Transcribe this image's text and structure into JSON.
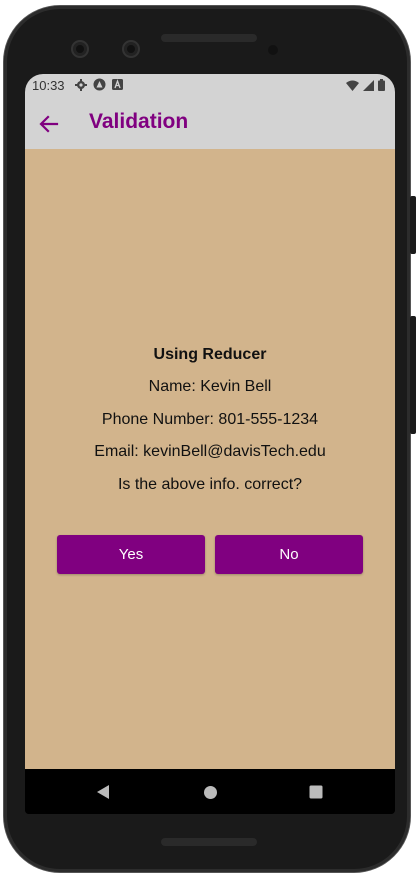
{
  "status_bar": {
    "time": "10:33",
    "left_icons": [
      "gear-icon",
      "app-circle-icon",
      "a-box-icon"
    ],
    "right_icons": [
      "wifi-icon",
      "cell-signal-icon",
      "battery-icon"
    ]
  },
  "app_bar": {
    "back_icon": "arrow-left-icon",
    "title": "Validation"
  },
  "summary": {
    "heading": "Using Reducer",
    "name_line": "Name: Kevin Bell",
    "phone_line": "Phone Number: 801-555-1234",
    "email_line": "Email: kevinBell@davisTech.edu",
    "question": "Is the above info. correct?"
  },
  "actions": {
    "yes_label": "Yes",
    "no_label": "No"
  },
  "nav_bar": {
    "items": [
      "back-triangle-icon",
      "home-circle-icon",
      "overview-square-icon"
    ]
  },
  "colors": {
    "accent": "#800080",
    "content_bg": "#d2b48c",
    "bar_bg": "#d3d3d3"
  }
}
